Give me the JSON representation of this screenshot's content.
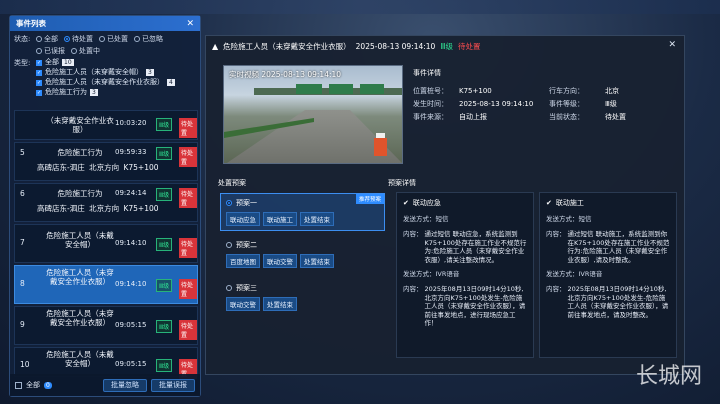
{
  "left": {
    "title": "事件列表",
    "status_label": "状态:",
    "status_options": [
      "全部",
      "待处置",
      "已处置",
      "已忽略",
      "已误报",
      "处置中"
    ],
    "type_label": "类型:",
    "types": [
      {
        "label": "全部",
        "count": "10"
      },
      {
        "label": "危险施工人员（未穿戴安全帽）",
        "count": "3"
      },
      {
        "label": "危险施工人员（未穿戴安全作业衣服）",
        "count": "4"
      },
      {
        "label": "危险施工行为",
        "count": "3"
      }
    ],
    "items": [
      {
        "num": "",
        "name": "（未穿戴安全作业衣服）",
        "time": "10:03:20",
        "level": "Ⅲ级",
        "status": "待处置",
        "road": ""
      },
      {
        "num": "5",
        "name": "危险施工行为",
        "time": "09:59:33",
        "level": "Ⅲ级",
        "status": "待处置",
        "road": "高碑店东-泗庄  北京方向  K75+100"
      },
      {
        "num": "6",
        "name": "危险施工行为",
        "time": "09:24:14",
        "level": "Ⅲ级",
        "status": "待处置",
        "road": "高碑店东-泗庄  北京方向  K75+100"
      },
      {
        "num": "7",
        "name": "危险施工人员（未戴安全帽）",
        "time": "09:14:10",
        "level": "Ⅲ级",
        "status": "待处置",
        "road": ""
      },
      {
        "num": "8",
        "name": "危险施工人员（未穿戴安全作业衣服）",
        "time": "09:14:10",
        "level": "Ⅲ级",
        "status": "待处置",
        "road": ""
      },
      {
        "num": "9",
        "name": "危险施工人员（未穿戴安全作业衣服）",
        "time": "09:05:15",
        "level": "Ⅲ级",
        "status": "待处置",
        "road": ""
      },
      {
        "num": "10",
        "name": "危险施工人员（未戴安全帽）",
        "time": "09:05:15",
        "level": "Ⅲ级",
        "status": "待处置",
        "road": ""
      }
    ],
    "footer": {
      "all_label": "全部",
      "all_count": "0",
      "ignore_btn": "批量忽略",
      "false_btn": "批量误报"
    }
  },
  "detail": {
    "title": "危险施工人员（未穿戴安全作业衣服）",
    "time": "2025-08-13 09:14:10",
    "level": "Ⅲ级",
    "status": "待处置",
    "video_title": "实时视频",
    "video_time": "2025-08-13 09:14:10",
    "info_title": "事件详情",
    "info": [
      {
        "k": "位置桩号：",
        "v": "K75+100",
        "k2": "行车方向：",
        "v2": "北京"
      },
      {
        "k": "发生时间：",
        "v": "2025-08-13 09:14:10",
        "k2": "事件等级：",
        "v2": "Ⅲ级"
      },
      {
        "k": "事件来源：",
        "v": "自动上报",
        "k2": "当前状态：",
        "v2": "待处置"
      }
    ],
    "plans_title": "处置预案",
    "recommend": "推荐预案",
    "plans": [
      {
        "name": "预案一",
        "buttons": [
          "联动应急",
          "联动施工",
          "处置结束"
        ]
      },
      {
        "name": "预案二",
        "buttons": [
          "百度地图",
          "联动交警",
          "处置结束"
        ]
      },
      {
        "name": "预案三",
        "buttons": [
          "联动交警",
          "处置结束"
        ]
      }
    ],
    "plan_detail_title": "预案详情",
    "cards": [
      {
        "title": "联动应急",
        "send1_label": "发送方式：",
        "send1": "短信",
        "content1_label": "内容：",
        "content1": "通过短信 联动应急，系统监测到K75+100处存在施工作业不规范行为:危险施工人员（未穿戴安全作业衣服）,请关注整改情况。",
        "send2_label": "发送方式：",
        "send2": "IVR语音",
        "content2_label": "内容：",
        "content2": "2025年08月13日09时14分10秒,北京方向K75+100处发生-危险施工人员（未穿戴安全作业衣服），请前往事发地点，进行现场应急工作！"
      },
      {
        "title": "联动施工",
        "send1_label": "发送方式：",
        "send1": "短信",
        "content1_label": "内容：",
        "content1": "通过短信 联动施工，系统监测到你在K75+100处存在施工作业不规范行为:危险施工人员（未穿戴安全作业衣服）,请及时整改。",
        "send2_label": "发送方式：",
        "send2": "IVR语音",
        "content2_label": "内容：",
        "content2": "2025年08月13日09时14分10秒,北京方向K75+100处发生-危险施工人员（未穿戴安全作业衣服），请前往事发地点，请及时整改。"
      }
    ]
  },
  "watermark": "长城网"
}
